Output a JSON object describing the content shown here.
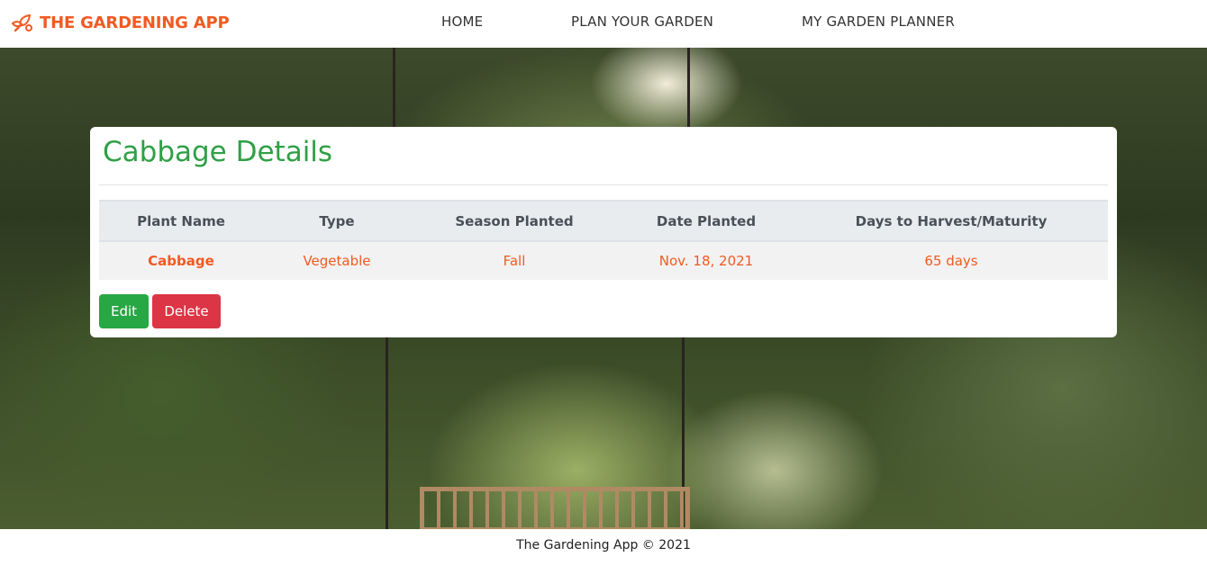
{
  "navbar": {
    "brand": "THE GARDENING APP",
    "brand_icon": "garden-tools-icon",
    "links": [
      "HOME",
      "PLAN YOUR GARDEN",
      "MY GARDEN PLANNER"
    ]
  },
  "card": {
    "title": "Cabbage Details",
    "table": {
      "headers": [
        "Plant Name",
        "Type",
        "Season Planted",
        "Date Planted",
        "Days to Harvest/Maturity"
      ],
      "row": [
        "Cabbage",
        "Vegetable",
        "Fall",
        "Nov. 18, 2021",
        "65 days"
      ]
    },
    "buttons": {
      "edit": "Edit",
      "delete": "Delete"
    }
  },
  "footer": {
    "text": "The Gardening App © 2021"
  },
  "colors": {
    "brand": "#f15a22",
    "title": "#2fa046",
    "edit": "#28a745",
    "delete": "#dc3545"
  }
}
